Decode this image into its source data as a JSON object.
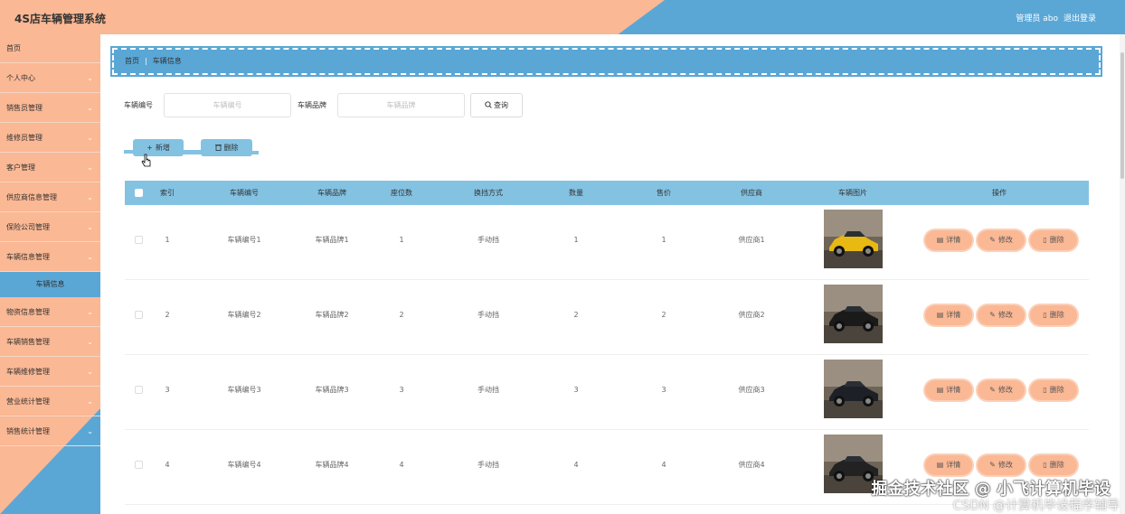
{
  "header": {
    "title": "4S店车辆管理系统",
    "user": "管理员 abo",
    "logout": "退出登录"
  },
  "sidebar": {
    "items": [
      {
        "label": "首页",
        "chevron": false
      },
      {
        "label": "个人中心",
        "chevron": true
      },
      {
        "label": "销售员管理",
        "chevron": true
      },
      {
        "label": "维修员管理",
        "chevron": true
      },
      {
        "label": "客户管理",
        "chevron": true
      },
      {
        "label": "供应商信息管理",
        "chevron": true
      },
      {
        "label": "保险公司管理",
        "chevron": true
      },
      {
        "label": "车辆信息管理",
        "chevron": true
      }
    ],
    "active_sub": "车辆信息",
    "items2": [
      {
        "label": "物资信息管理"
      },
      {
        "label": "车辆销售管理"
      },
      {
        "label": "车辆维修管理"
      },
      {
        "label": "营业统计管理"
      },
      {
        "label": "销售统计管理"
      }
    ]
  },
  "breadcrumb": {
    "home": "首页",
    "current": "车辆信息"
  },
  "search": {
    "label1": "车辆编号",
    "placeholder1": "车辆编号",
    "label2": "车辆品牌",
    "placeholder2": "车辆品牌",
    "button": "查询"
  },
  "actions": {
    "add": "新增",
    "delete": "删除"
  },
  "table": {
    "headers": [
      "索引",
      "车辆编号",
      "车辆品牌",
      "座位数",
      "换挡方式",
      "数量",
      "售价",
      "供应商",
      "车辆图片",
      "操作"
    ],
    "rows": [
      {
        "index": "1",
        "code": "车辆编号1",
        "brand": "车辆品牌1",
        "seats": "1",
        "gear": "手动挡",
        "qty": "1",
        "price": "1",
        "supplier": "供应商1",
        "car_color": "#e8b813"
      },
      {
        "index": "2",
        "code": "车辆编号2",
        "brand": "车辆品牌2",
        "seats": "2",
        "gear": "手动挡",
        "qty": "2",
        "price": "2",
        "supplier": "供应商2",
        "car_color": "#1a1a1a"
      },
      {
        "index": "3",
        "code": "车辆编号3",
        "brand": "车辆品牌3",
        "seats": "3",
        "gear": "手动挡",
        "qty": "3",
        "price": "3",
        "supplier": "供应商3",
        "car_color": "#1d2127"
      },
      {
        "index": "4",
        "code": "车辆编号4",
        "brand": "车辆品牌4",
        "seats": "4",
        "gear": "手动挡",
        "qty": "4",
        "price": "4",
        "supplier": "供应商4",
        "car_color": "#222"
      }
    ],
    "op_detail": "详情",
    "op_edit": "修改",
    "op_delete": "删除"
  },
  "watermark": {
    "line1": "掘金技术社区 @ 小飞计算机毕设",
    "line2": "CSDN @计算机毕设程序辅导"
  },
  "colors": {
    "peach": "#fbb894",
    "blue": "#5aa7d6",
    "light_blue": "#84c2e2"
  }
}
